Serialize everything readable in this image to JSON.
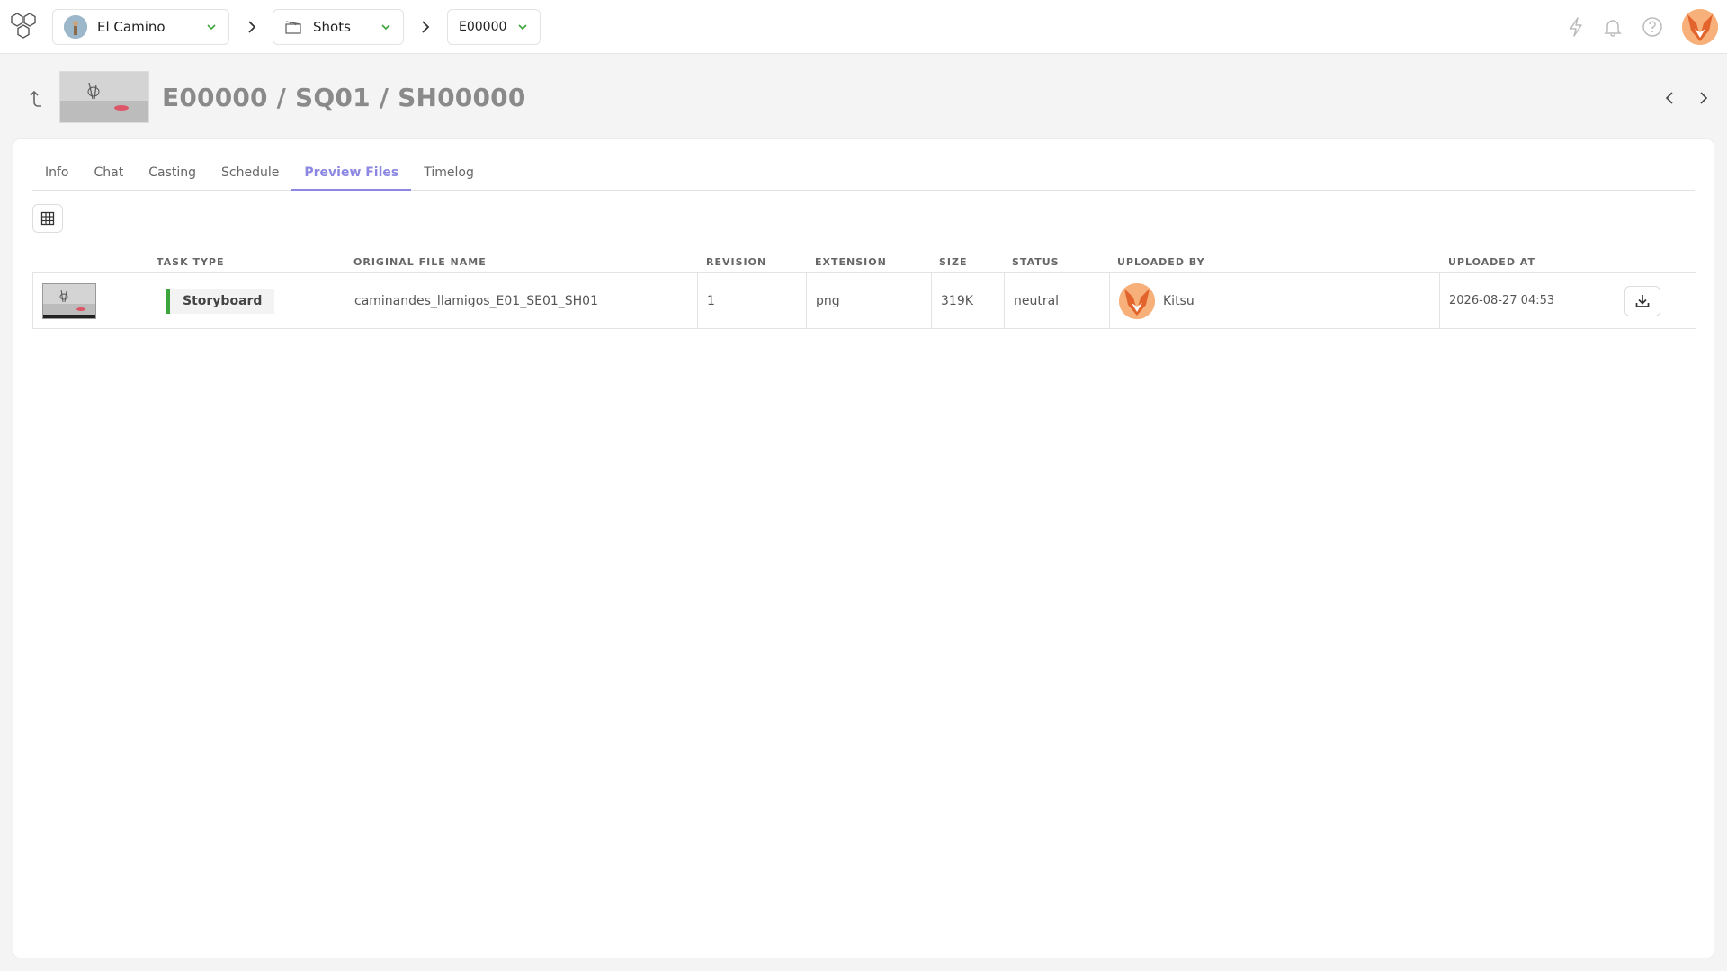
{
  "topbar": {
    "project": "El Camino",
    "section": "Shots",
    "episode": "E00000"
  },
  "header": {
    "title": "E00000 / SQ01 / SH00000"
  },
  "tabs": [
    {
      "label": "Info"
    },
    {
      "label": "Chat"
    },
    {
      "label": "Casting"
    },
    {
      "label": "Schedule"
    },
    {
      "label": "Preview Files"
    },
    {
      "label": "Timelog"
    }
  ],
  "table": {
    "columns": {
      "task_type": "TASK TYPE",
      "file_name": "ORIGINAL FILE NAME",
      "revision": "REVISION",
      "extension": "EXTENSION",
      "size": "SIZE",
      "status": "STATUS",
      "uploaded_by": "UPLOADED BY",
      "uploaded_at": "UPLOADED AT"
    },
    "rows": [
      {
        "task_type": "Storyboard",
        "file_name": "caminandes_llamigos_E01_SE01_SH01",
        "revision": "1",
        "extension": "png",
        "size": "319K",
        "status": "neutral",
        "uploaded_by": "Kitsu",
        "uploaded_at": "2026-08-27 04:53"
      }
    ]
  },
  "colors": {
    "accent": "#8c87e0",
    "storyboard": "#3ba43b"
  }
}
